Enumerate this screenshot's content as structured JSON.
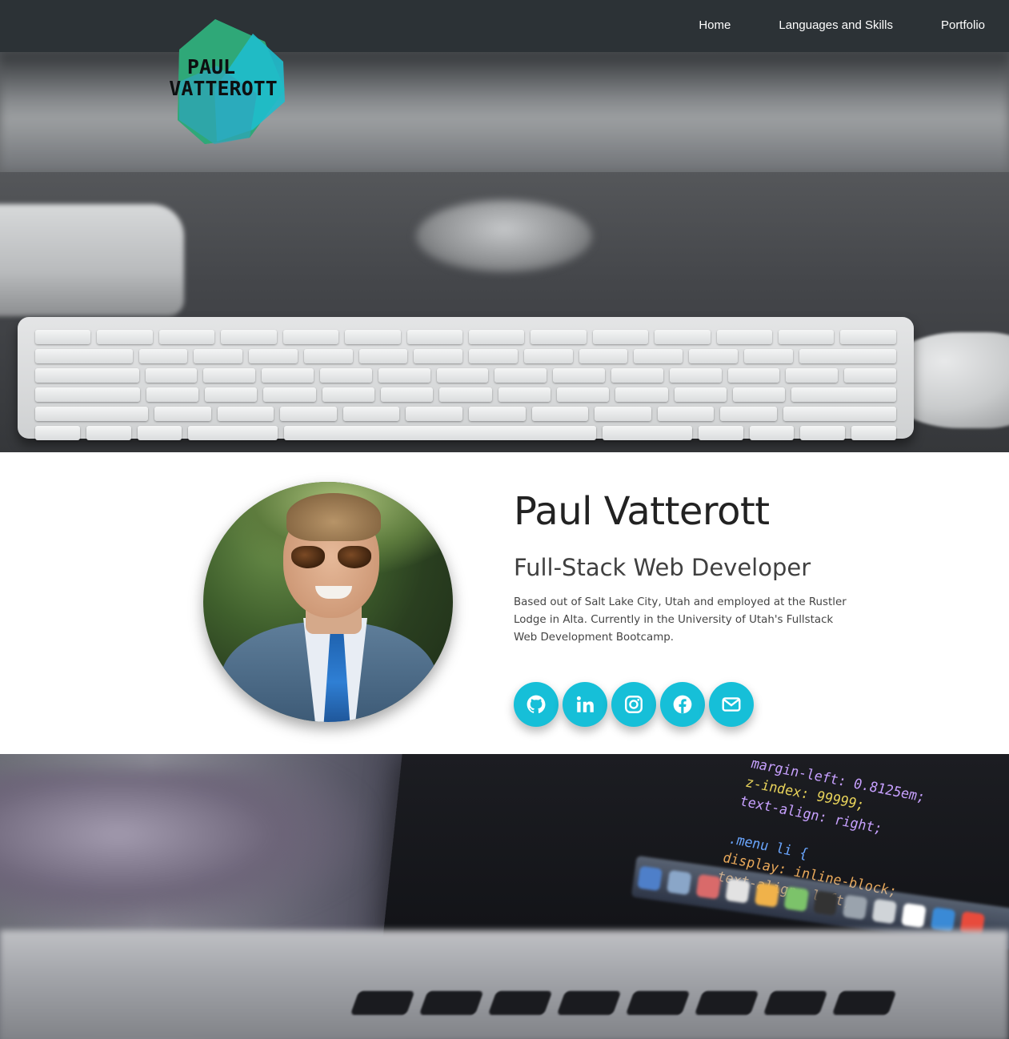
{
  "nav": {
    "links": [
      "Home",
      "Languages and Skills",
      "Portfolio"
    ]
  },
  "logo": {
    "line1": "PAUL",
    "line2": "VATTEROTT",
    "colors": [
      "#2ea77a",
      "#1fb9c9",
      "#3aa4d6"
    ]
  },
  "profile": {
    "name": "Paul Vatterott",
    "title": "Full-Stack Web Developer",
    "bio": "Based out of Salt Lake City, Utah and employed at the Rustler Lodge in Alta. Currently in the University of Utah's Fullstack Web Development Bootcamp."
  },
  "socials": [
    {
      "icon": "github-icon"
    },
    {
      "icon": "linkedin-icon"
    },
    {
      "icon": "instagram-icon"
    },
    {
      "icon": "facebook-icon"
    },
    {
      "icon": "email-icon"
    }
  ],
  "code_snippet": [
    "  margin-left: 0.8125em;",
    "  z-index: 99999;",
    "  text-align: right;",
    "",
    ".menu li {",
    "  display: inline-block;",
    "  text-align: left;"
  ],
  "theme": {
    "navbar": "#2c3236",
    "accent": "#16bfd8"
  }
}
